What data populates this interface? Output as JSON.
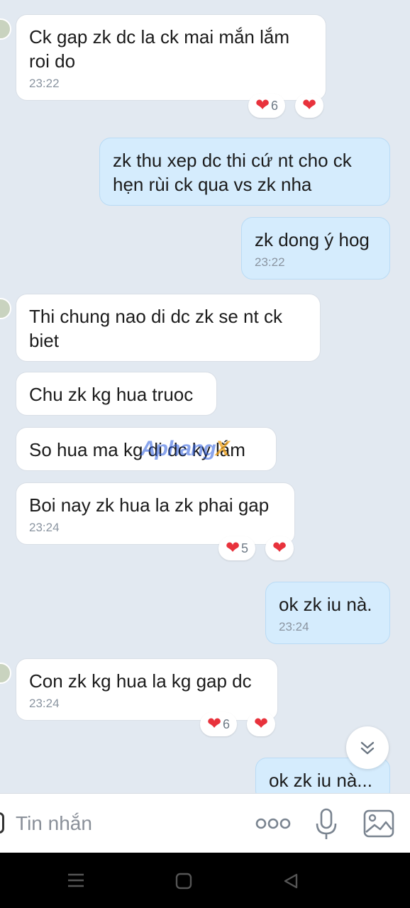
{
  "messages": [
    {
      "side": "in",
      "text": "Ck gap zk dc la ck mai mắn lắm roi do",
      "time": "23:22",
      "reactions": [
        {
          "emoji": "heart-icon",
          "count": "6"
        },
        {
          "emoji": "heart-icon",
          "count": ""
        }
      ]
    },
    {
      "side": "out",
      "text": "zk thu xep dc thi cứ nt cho ck hẹn rùi ck qua vs zk nha",
      "time": ""
    },
    {
      "side": "out",
      "text": "zk dong ý hog",
      "time": "23:22"
    },
    {
      "side": "in",
      "text": "Thi chung nao di dc zk se nt ck biet",
      "time": ""
    },
    {
      "side": "in",
      "text": "Chu zk kg hua truoc",
      "time": ""
    },
    {
      "side": "in",
      "text": "So hua ma kg di dc  ky lắm",
      "time": ""
    },
    {
      "side": "in",
      "text": "Boi nay zk hua la zk phai gap",
      "time": "23:24",
      "reactions": [
        {
          "emoji": "heart-icon",
          "count": "5"
        },
        {
          "emoji": "heart-icon",
          "count": ""
        }
      ]
    },
    {
      "side": "out",
      "text": "ok zk iu nà.",
      "time": "23:24"
    },
    {
      "side": "in",
      "text": "Con zk kg hua la kg gap dc",
      "time": "23:24",
      "reactions": [
        {
          "emoji": "heart-icon",
          "count": "6"
        },
        {
          "emoji": "heart-icon",
          "count": ""
        }
      ]
    },
    {
      "side": "out",
      "text": "ok zk iu nà...",
      "time": ""
    }
  ],
  "watermark": {
    "main": "Aphang",
    "accent": "X"
  },
  "input": {
    "placeholder": "Tin nhắn"
  },
  "icons": {
    "more": "more-dots-icon",
    "mic": "microphone-icon",
    "image": "image-icon",
    "scroll": "scroll-down-icon"
  },
  "colors": {
    "background": "#e2e9f1",
    "incoming": "#ffffff",
    "outgoing": "#d5ecfd",
    "heart": "#e8323c"
  }
}
